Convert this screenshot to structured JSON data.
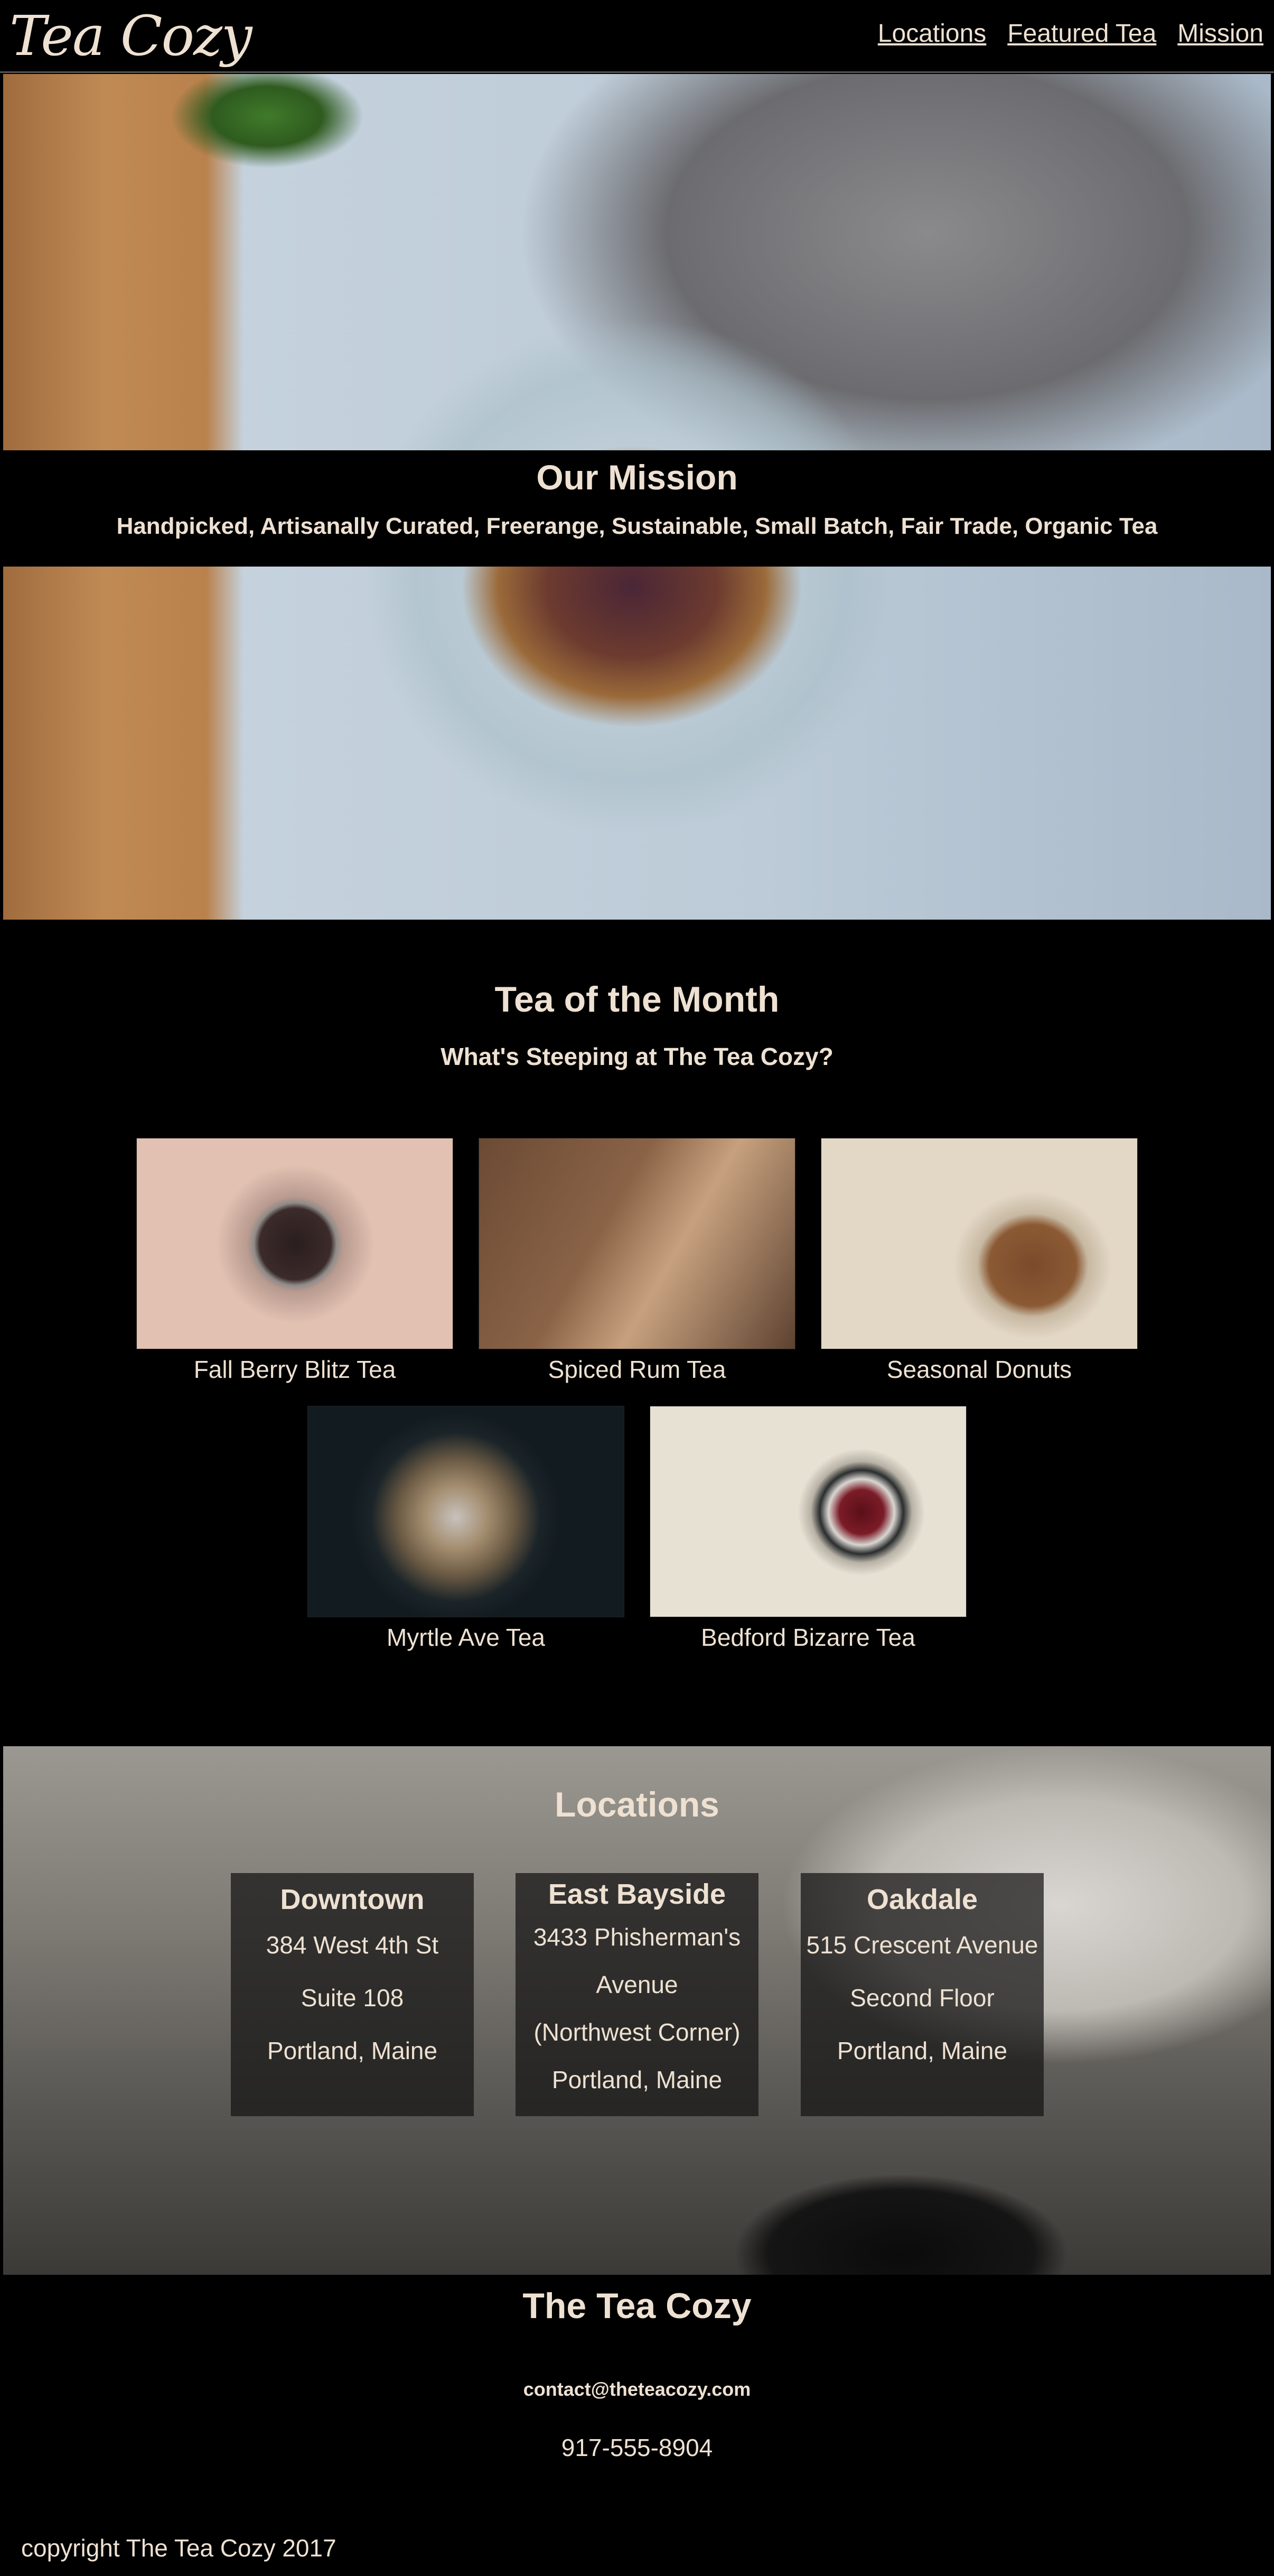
{
  "header": {
    "logo": "Tea Cozy",
    "nav": [
      "Locations",
      "Featured Tea",
      "Mission"
    ]
  },
  "mission": {
    "title": "Our Mission",
    "subtitle": "Handpicked, Artisanally Curated, Freerange, Sustainable, Small Batch, Fair Trade, Organic Tea"
  },
  "tea_of_month": {
    "title": "Tea of the Month",
    "subtitle": "What's Steeping at The Tea Cozy?",
    "items": [
      {
        "name": "Fall Berry Blitz Tea"
      },
      {
        "name": "Spiced Rum Tea"
      },
      {
        "name": "Seasonal Donuts"
      },
      {
        "name": "Myrtle Ave Tea"
      },
      {
        "name": "Bedford Bizarre Tea"
      }
    ]
  },
  "locations": {
    "title": "Locations",
    "list": [
      {
        "name": "Downtown",
        "lines": [
          "384 West 4th St",
          "Suite 108",
          "Portland, Maine"
        ]
      },
      {
        "name": "East Bayside",
        "lines": [
          "3433 Phisherman's",
          "Avenue",
          "(Northwest Corner)",
          "Portland, Maine"
        ]
      },
      {
        "name": "Oakdale",
        "lines": [
          "515 Crescent Avenue",
          "Second Floor",
          "Portland, Maine"
        ]
      }
    ]
  },
  "footer": {
    "title": "The Tea Cozy",
    "email": "contact@theteacozy.com",
    "phone": "917-555-8904",
    "copyright": "copyright The Tea Cozy 2017"
  }
}
